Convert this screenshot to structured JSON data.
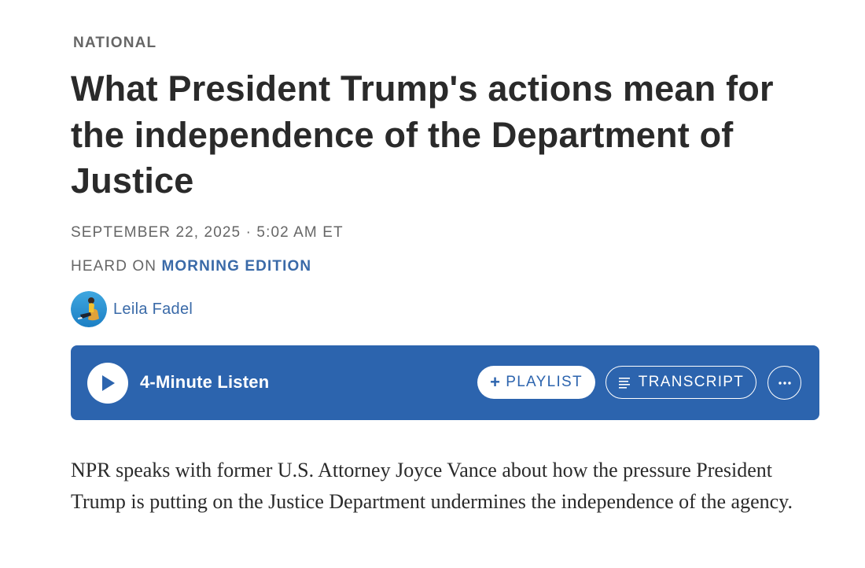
{
  "article": {
    "section": "NATIONAL",
    "headline": "What President Trump's actions mean for the independence of the Department of Justice",
    "dateline": "SEPTEMBER 22, 2025 · 5:02 AM ET",
    "heard_on_prefix": "HEARD ON",
    "program": "MORNING EDITION",
    "author": "Leila Fadel",
    "teaser": "NPR speaks with former U.S. Attorney Joyce Vance about how the pressure President Trump is putting on the Justice Department undermines the independence of the agency."
  },
  "player": {
    "listen_label": "4-Minute Listen",
    "playlist_label": "PLAYLIST",
    "transcript_label": "TRANSCRIPT",
    "play_icon": "play-icon",
    "more_icon": "more-horizontal-icon"
  },
  "colors": {
    "player_background": "#2c64ae",
    "link": "#3a6aa8",
    "meta_text": "#666666",
    "headline_text": "#2a2a2a"
  }
}
